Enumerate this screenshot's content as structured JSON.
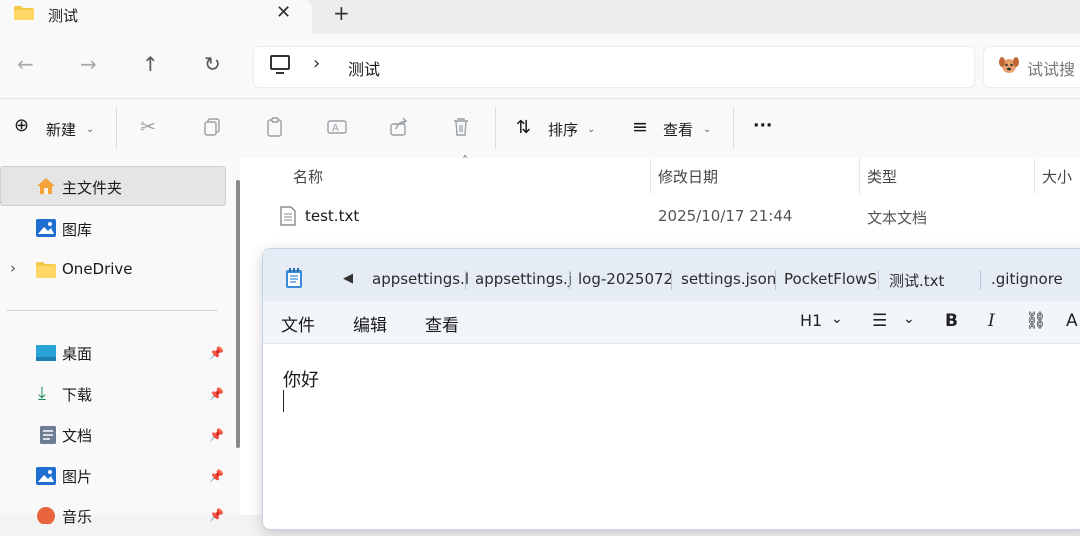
{
  "explorer": {
    "tab_title": "测试",
    "address": {
      "segment": "测试"
    },
    "search": {
      "placeholder": "试试搜"
    },
    "toolbar": {
      "new_label": "新建",
      "sort_label": "排序",
      "view_label": "查看",
      "more_label": "···"
    },
    "sidebar": {
      "items": [
        {
          "label": "主文件夹",
          "icon": "home-icon",
          "selected": true
        },
        {
          "label": "图库",
          "icon": "gallery-icon"
        },
        {
          "label": "OneDrive",
          "icon": "folder-icon",
          "expandable": true
        }
      ],
      "pinned": [
        {
          "label": "桌面",
          "icon": "desktop-icon"
        },
        {
          "label": "下载",
          "icon": "download-icon"
        },
        {
          "label": "文档",
          "icon": "document-icon"
        },
        {
          "label": "图片",
          "icon": "pictures-icon"
        },
        {
          "label": "音乐",
          "icon": "music-icon"
        }
      ]
    },
    "columns": {
      "name": "名称",
      "modified": "修改日期",
      "type": "类型",
      "size": "大小"
    },
    "files": [
      {
        "name": "test.txt",
        "modified": "2025/10/17 21:44",
        "type": "文本文档"
      }
    ]
  },
  "notepad": {
    "tabs": [
      "appsettings.l",
      "appsettings.j",
      "log-2025072",
      "settings.json",
      "PocketFlowS",
      "测试.txt",
      ".gitignore"
    ],
    "active_tab_index": 5,
    "menu": {
      "file": "文件",
      "edit": "编辑",
      "view": "查看"
    },
    "format": {
      "heading": "H1",
      "bold": "B",
      "italic": "I"
    },
    "content": "你好"
  },
  "colors": {
    "accent": "#0067c0",
    "folder": "#f7c948"
  }
}
